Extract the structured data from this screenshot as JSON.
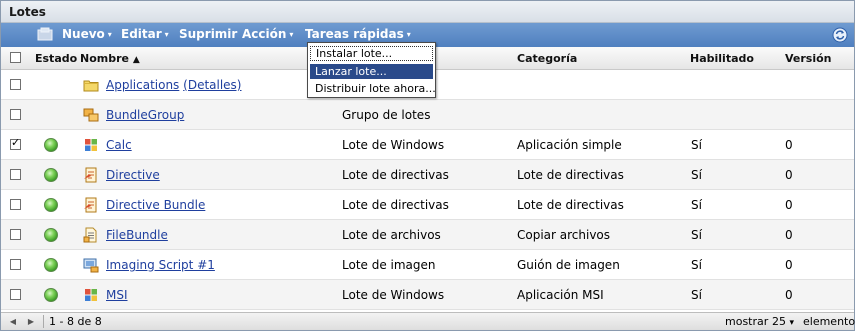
{
  "title": "Lotes",
  "toolbar": {
    "items": [
      {
        "label": "Nuevo"
      },
      {
        "label": "Editar"
      },
      {
        "label": "Suprimir"
      },
      {
        "label": "Acción"
      },
      {
        "label": "Tareas rápidas"
      }
    ],
    "caret": "▾"
  },
  "dropdown": {
    "items": [
      "Instalar lote...",
      "Lanzar lote...",
      "Distribuir lote ahora..."
    ],
    "highlighted": "Lanzar lote..."
  },
  "columns": {
    "estado": "Estado",
    "nombre": "Nombre",
    "sort_indicator": "▲",
    "tipo": "",
    "categoria": "Categoría",
    "habilitado": "Habilitado",
    "version": "Versión"
  },
  "rows": [
    {
      "icon": "folder-icon",
      "name": "Applications",
      "details": "(Detalles)",
      "type": "",
      "category": "",
      "enabled": "",
      "version": "",
      "checked": false,
      "status": false
    },
    {
      "icon": "bundle-group-icon",
      "name": "BundleGroup",
      "type": "Grupo de lotes",
      "category": "",
      "enabled": "",
      "version": "",
      "checked": false,
      "status": false
    },
    {
      "icon": "windows-bundle-icon",
      "name": "Calc",
      "type": "Lote de Windows",
      "category": "Aplicación simple",
      "enabled": "Sí",
      "version": "0",
      "checked": true,
      "status": true
    },
    {
      "icon": "directive-bundle-icon",
      "name": "Directive",
      "type": "Lote de directivas",
      "category": "Lote de directivas",
      "enabled": "Sí",
      "version": "0",
      "checked": false,
      "status": true
    },
    {
      "icon": "directive-bundle-icon",
      "name": "Directive Bundle",
      "type": "Lote de directivas",
      "category": "Lote de directivas",
      "enabled": "Sí",
      "version": "0",
      "checked": false,
      "status": true
    },
    {
      "icon": "file-bundle-icon",
      "name": "FileBundle",
      "type": "Lote de archivos",
      "category": "Copiar archivos",
      "enabled": "Sí",
      "version": "0",
      "checked": false,
      "status": true
    },
    {
      "icon": "imaging-bundle-icon",
      "name": "Imaging Script #1",
      "type": "Lote de imagen",
      "category": "Guión de imagen",
      "enabled": "Sí",
      "version": "0",
      "checked": false,
      "status": true
    },
    {
      "icon": "windows-bundle-icon",
      "name": "MSI",
      "type": "Lote de Windows",
      "category": "Aplicación MSI",
      "enabled": "Sí",
      "version": "0",
      "checked": false,
      "status": true
    }
  ],
  "footer": {
    "range": "1 - 8 de 8",
    "show_label": "mostrar",
    "page_size": "25",
    "unit": "elementos"
  },
  "colors": {
    "toolbar": "#5b8ac7",
    "link": "#1f3f9e",
    "menu_highlight": "#2a4a8a"
  }
}
